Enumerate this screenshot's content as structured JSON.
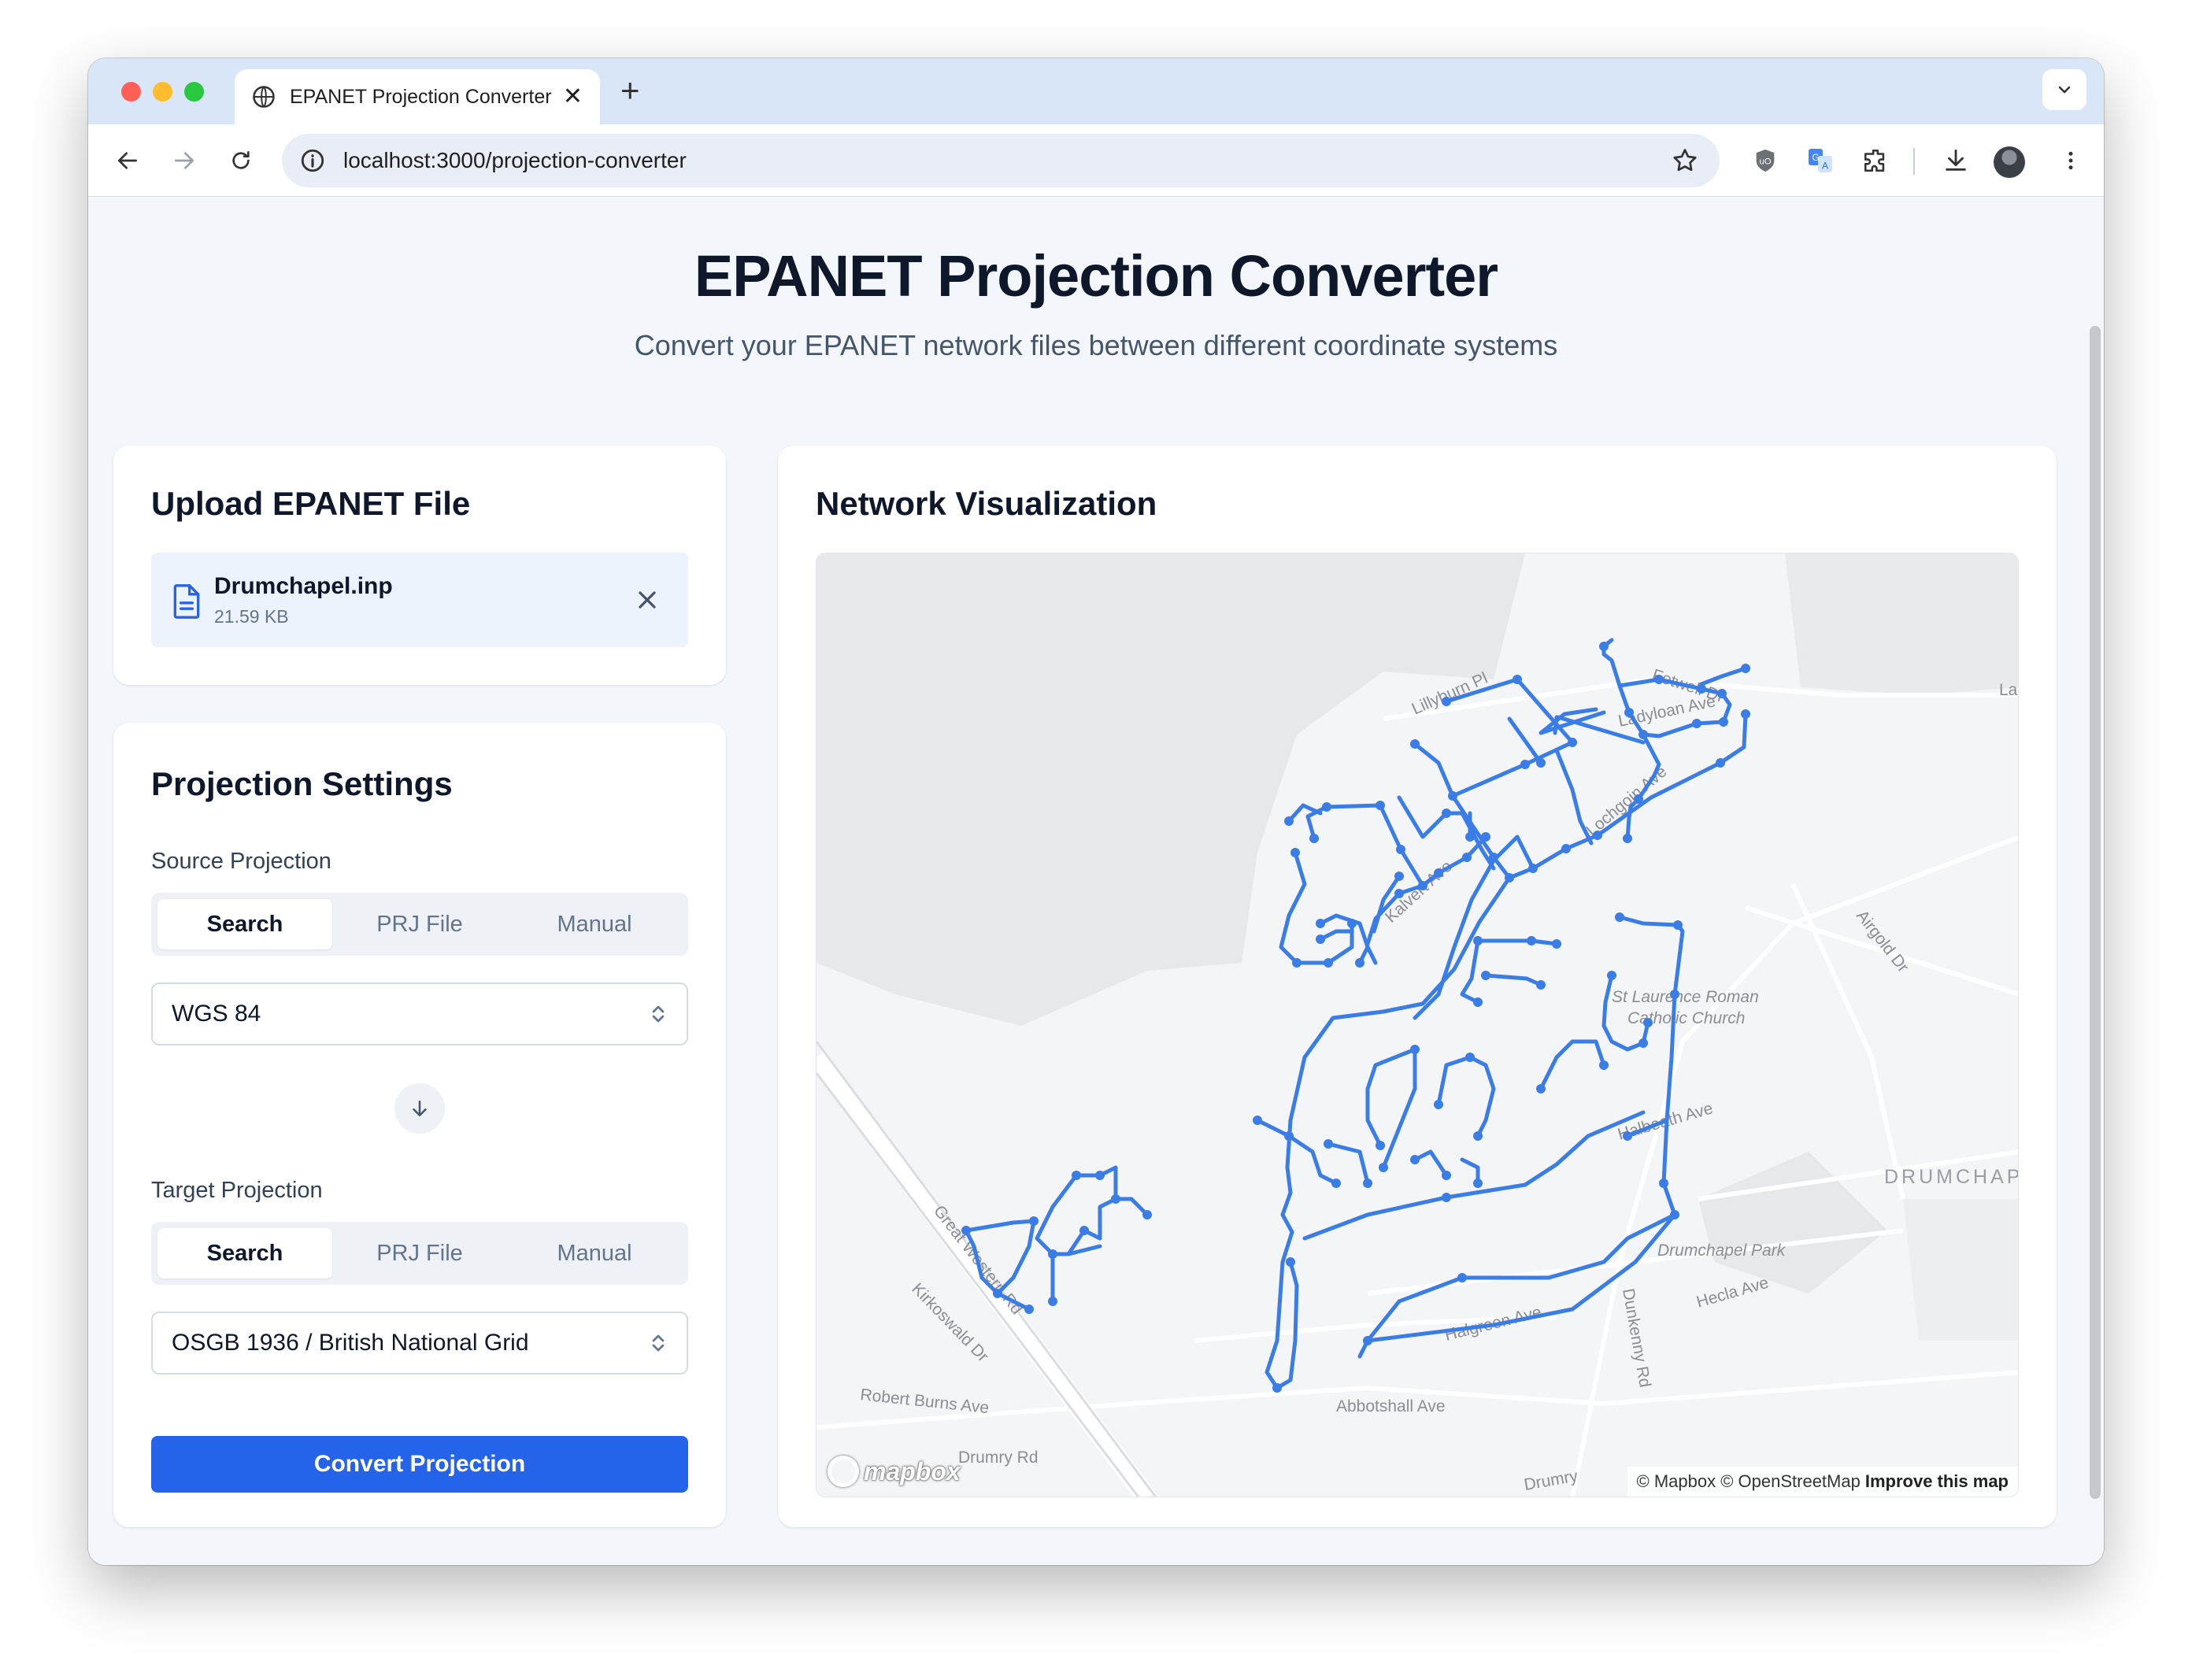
{
  "browser": {
    "tab_title": "EPANET Projection Converter",
    "tab_close": "✕",
    "new_tab": "+",
    "url": "localhost:3000/projection-converter",
    "icons": [
      "globe-icon",
      "back-icon",
      "forward-icon",
      "reload-icon",
      "info-icon",
      "star-icon",
      "ublock-icon",
      "translate-icon",
      "extensions-icon",
      "download-icon",
      "avatar",
      "more-icon"
    ]
  },
  "header": {
    "title": "EPANET Projection Converter",
    "subtitle": "Convert your EPANET network files between different coordinate systems"
  },
  "upload": {
    "title": "Upload EPANET File",
    "file_name": "Drumchapel.inp",
    "file_size": "21.59 KB"
  },
  "settings": {
    "title": "Projection Settings",
    "source_label": "Source Projection",
    "target_label": "Target Projection",
    "tabs": [
      "Search",
      "PRJ File",
      "Manual"
    ],
    "active_tab": "Search",
    "source_value": "WGS 84",
    "target_value": "OSGB 1936 / British National Grid",
    "convert_label": "Convert Projection"
  },
  "visualization": {
    "title": "Network Visualization",
    "map_labels": {
      "lillyburn": "Lillyburn Pl",
      "fotwell": "Fotwell Dr",
      "ladyloan": "Ladyloan Ave",
      "lochgoin": "Lochgoin Ave",
      "kalvert": "Kalvert Ave",
      "la": "La",
      "airgold": "Airgold Dr",
      "church1": "St Laurence Roman",
      "church2": "Catholic Church",
      "halbeath": "Halbeath Ave",
      "drumchap": "DRUMCHAP",
      "park": "Drumchapel Park",
      "hecla": "Hecla Ave",
      "great_western": "Great Western Rd",
      "kirkoswald": "Kirkoswald Dr",
      "robert_burns": "Robert Burns Ave",
      "drumry1": "Drumry Rd",
      "drumry2": "Drumry",
      "halgreen": "Halgreen Ave",
      "dunkenny": "Dunkenny Rd",
      "abbotshall": "Abbotshall Ave"
    },
    "logo_text": "mapbox",
    "attribution": "© Mapbox © OpenStreetMap",
    "improve": "Improve this map",
    "network_color": "#3b7de6"
  }
}
